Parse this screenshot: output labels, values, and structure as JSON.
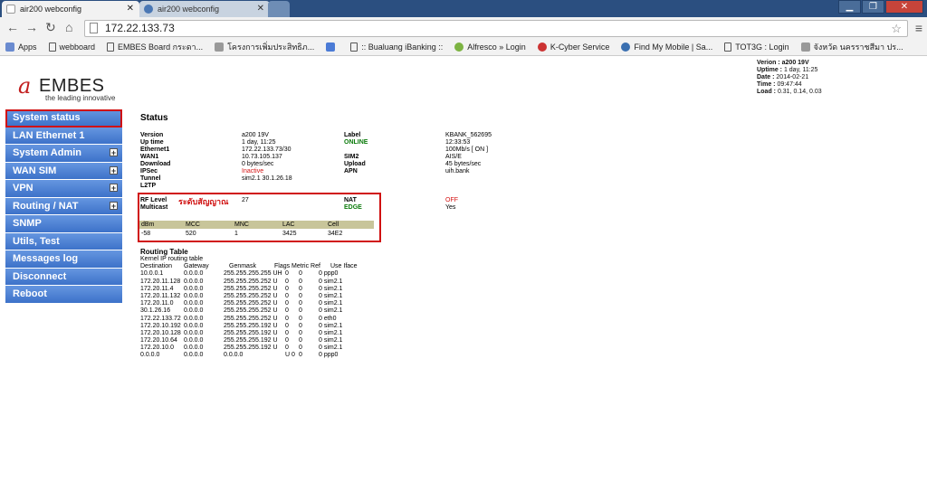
{
  "browser": {
    "tabs": [
      {
        "title": "air200 webconfig",
        "active": true
      },
      {
        "title": "air200 webconfig",
        "active": false
      }
    ],
    "url": "172.22.133.73",
    "bookmarks": [
      {
        "label": "Apps",
        "icon": "apps-icon"
      },
      {
        "label": "webboard",
        "icon": "page-icon"
      },
      {
        "label": "EMBES Board กระดา...",
        "icon": "page-icon"
      },
      {
        "label": "โครงการเพิ่มประสิทธิภ...",
        "icon": "site-icon"
      },
      {
        "label": "",
        "icon": "google-icon"
      },
      {
        "label": ":: Bualuang iBanking ::",
        "icon": "page-icon"
      },
      {
        "label": "Alfresco » Login",
        "icon": "alfresco-icon"
      },
      {
        "label": "K-Cyber Service",
        "icon": "kbank-icon"
      },
      {
        "label": "Find My Mobile | Sa...",
        "icon": "globe-icon"
      },
      {
        "label": "TOT3G : Login",
        "icon": "page-icon"
      },
      {
        "label": "จังหวัด นครราชสีมา ปร...",
        "icon": "site-icon"
      }
    ]
  },
  "logo": {
    "brand": "EMBES",
    "tagline": "the leading innovative"
  },
  "sysinfo": {
    "version_label": "Verion :",
    "version": "a200 19V",
    "uptime_label": "Uptime :",
    "uptime": "1 day, 11:25",
    "date_label": "Date :",
    "date": "2014-02-21",
    "time_label": "Time :",
    "time": "09:47:44",
    "load_label": "Load :",
    "load": "0.31, 0.14, 0.03"
  },
  "sidebar": {
    "items": [
      {
        "label": "System status",
        "expandable": false,
        "selected": true
      },
      {
        "label": "LAN Ethernet 1",
        "expandable": false
      },
      {
        "label": "System Admin",
        "expandable": true
      },
      {
        "label": "WAN SIM",
        "expandable": true
      },
      {
        "label": "VPN",
        "expandable": true
      },
      {
        "label": "Routing / NAT",
        "expandable": true
      },
      {
        "label": "SNMP",
        "expandable": false
      },
      {
        "label": "Utils, Test",
        "expandable": false
      },
      {
        "label": "Messages log",
        "expandable": false
      },
      {
        "label": "Disconnect",
        "expandable": false
      },
      {
        "label": "Reboot",
        "expandable": false
      }
    ]
  },
  "status": {
    "title": "Status",
    "left": [
      {
        "label": "Version",
        "value": "a200 19V"
      },
      {
        "label": "Up time",
        "value": "1 day, 11:25"
      },
      {
        "label": "Ethernet1",
        "value": "172.22.133.73/30"
      },
      {
        "label": "WAN1",
        "value": "10.73.105.137"
      },
      {
        "label": "Download",
        "value": "0 bytes/sec"
      },
      {
        "label": "IPSec",
        "value": "Inactive"
      },
      {
        "label": "Tunnel",
        "value": "sim2.1 30.1.26.18"
      },
      {
        "label": "L2TP",
        "value": ""
      }
    ],
    "right": [
      {
        "label": "Label",
        "value": "KBANK_562695"
      },
      {
        "label": "ONLINE",
        "value": "12:33:53"
      },
      {
        "label": "",
        "value": "100Mb/s [ ON ]"
      },
      {
        "label": "SIM2",
        "value": "AIS/E"
      },
      {
        "label": "Upload",
        "value": "45 bytes/sec"
      },
      {
        "label": "APN",
        "value": "uih.bank"
      }
    ],
    "rf": {
      "rf_label": "RF Level",
      "rf_value": "27",
      "thai_note": "ระดับสัญญาณ",
      "multicast_label": "Multicast",
      "nat_label": "NAT",
      "nat_value": "OFF",
      "edge_label": "EDGE",
      "edge_value": "Yes",
      "headers": [
        "dBm",
        "MCC",
        "MNC",
        "LAC",
        "Cell"
      ],
      "values": [
        "-58",
        "520",
        "1",
        "3425",
        "34E2"
      ]
    }
  },
  "routing": {
    "title": "Routing Table",
    "subtitle": "Kernel IP routing table",
    "headers": [
      "Destination",
      "Gateway",
      "Genmask",
      "Flags Metric Ref",
      "Use Iface"
    ],
    "rows": [
      [
        "10.0.0.1",
        "0.0.0.0",
        "255.255.255.255 UH",
        "0",
        "0",
        "0 ppp0"
      ],
      [
        "172.20.11.128",
        "0.0.0.0",
        "255.255.255.252 U",
        "0",
        "0",
        "0 sim2.1"
      ],
      [
        "172.20.11.4",
        "0.0.0.0",
        "255.255.255.252 U",
        "0",
        "0",
        "0 sim2.1"
      ],
      [
        "172.20.11.132",
        "0.0.0.0",
        "255.255.255.252 U",
        "0",
        "0",
        "0 sim2.1"
      ],
      [
        "172.20.11.0",
        "0.0.0.0",
        "255.255.255.252 U",
        "0",
        "0",
        "0 sim2.1"
      ],
      [
        "30.1.26.16",
        "0.0.0.0",
        "255.255.255.252 U",
        "0",
        "0",
        "0 sim2.1"
      ],
      [
        "172.22.133.72",
        "0.0.0.0",
        "255.255.255.252 U",
        "0",
        "0",
        "0 eth0"
      ],
      [
        "172.20.10.192",
        "0.0.0.0",
        "255.255.255.192 U",
        "0",
        "0",
        "0 sim2.1"
      ],
      [
        "172.20.10.128",
        "0.0.0.0",
        "255.255.255.192 U",
        "0",
        "0",
        "0 sim2.1"
      ],
      [
        "172.20.10.64",
        "0.0.0.0",
        "255.255.255.192 U",
        "0",
        "0",
        "0 sim2.1"
      ],
      [
        "172.20.10.0",
        "0.0.0.0",
        "255.255.255.192 U",
        "0",
        "0",
        "0 sim2.1"
      ],
      [
        "0.0.0.0",
        "0.0.0.0",
        "0.0.0.0",
        "U 0",
        "0",
        "0 ppp0"
      ]
    ]
  }
}
